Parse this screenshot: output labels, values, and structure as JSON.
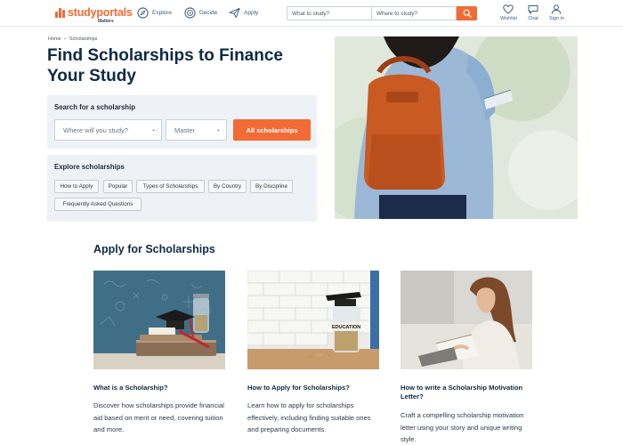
{
  "header": {
    "logo_word": "studyportals",
    "logo_sub": "Matters",
    "nav": [
      {
        "label": "Explore",
        "icon": "compass-icon"
      },
      {
        "label": "Decide",
        "icon": "target-icon"
      },
      {
        "label": "Apply",
        "icon": "paper-plane-icon"
      }
    ],
    "search": {
      "what_placeholder": "What to study?",
      "where_placeholder": "Where to study?"
    },
    "actions": [
      {
        "label": "Wishlist",
        "icon": "heart-icon"
      },
      {
        "label": "Chat",
        "icon": "chat-icon"
      },
      {
        "label": "Sign in",
        "icon": "user-icon"
      }
    ],
    "accent_color": "#f26b35"
  },
  "breadcrumb": {
    "home": "Home",
    "separator": ">",
    "current": "Scholarships"
  },
  "hero": {
    "title": "Find Scholarships to Finance Your Study"
  },
  "search_panel": {
    "title": "Search for a scholarship",
    "location_placeholder": "Where will you study?",
    "degree_value": "Master",
    "button_label": "All scholarships"
  },
  "explore_panel": {
    "title": "Explore scholarships",
    "chips": [
      "How to Apply",
      "Popular",
      "Types of Scholarships",
      "By Country",
      "By Discipline",
      "Frequently Asked Questions"
    ]
  },
  "apply_section": {
    "title": "Apply for Scholarships",
    "cards": [
      {
        "title": "What is a Scholarship?",
        "description": "Discover how scholarships provide financial aid based on merit or need, covering tuition and more."
      },
      {
        "title": "How to Apply for Scholarships?",
        "description": "Learn how to apply for scholarships effectively, including finding suitable ones and preparing documents.",
        "jar_label": "EDUCATION"
      },
      {
        "title": "How to write a Scholarship Motivation Letter?",
        "description": "Craft a compelling scholarship motivation letter using your story and unique writing style."
      }
    ]
  }
}
